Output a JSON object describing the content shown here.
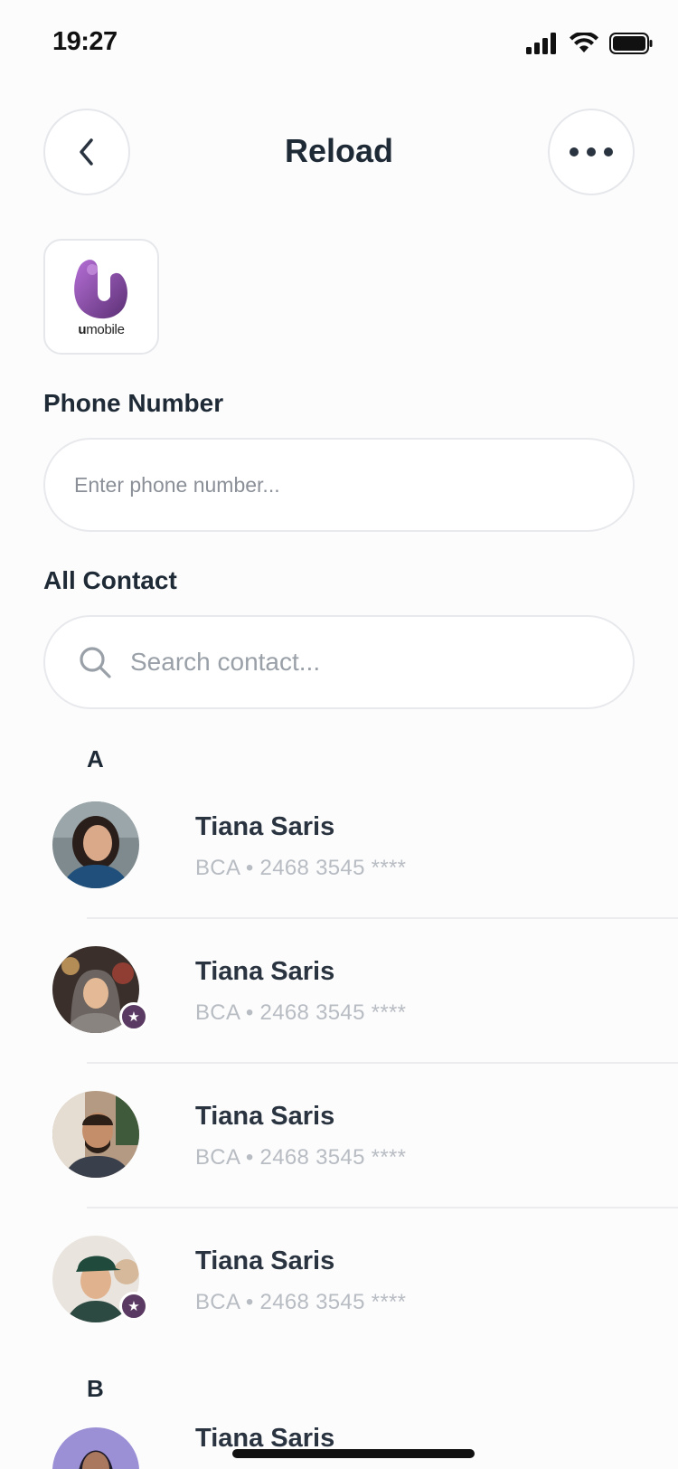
{
  "status_bar": {
    "time": "19:27"
  },
  "header": {
    "title": "Reload"
  },
  "provider": {
    "brand_prefix": "u",
    "brand_suffix": "mobile",
    "brand_color": "#8e4fb8"
  },
  "phone_section": {
    "label": "Phone Number",
    "placeholder": "Enter phone number..."
  },
  "contacts_section": {
    "label": "All Contact",
    "search_placeholder": "Search contact..."
  },
  "groups": [
    {
      "letter": "A",
      "contacts": [
        {
          "name": "Tiana Saris",
          "detail": "BCA • 2468 3545 ****",
          "favorite": false
        },
        {
          "name": "Tiana Saris",
          "detail": "BCA • 2468 3545 ****",
          "favorite": true
        },
        {
          "name": "Tiana Saris",
          "detail": "BCA • 2468 3545 ****",
          "favorite": false
        },
        {
          "name": "Tiana Saris",
          "detail": "BCA • 2468 3545 ****",
          "favorite": true
        }
      ]
    },
    {
      "letter": "B",
      "contacts": [
        {
          "name": "Tiana Saris",
          "detail": "",
          "favorite": false
        }
      ]
    }
  ],
  "colors": {
    "accent": "#5a3a62",
    "text": "#1f2a37",
    "muted": "#b8bcc3"
  }
}
